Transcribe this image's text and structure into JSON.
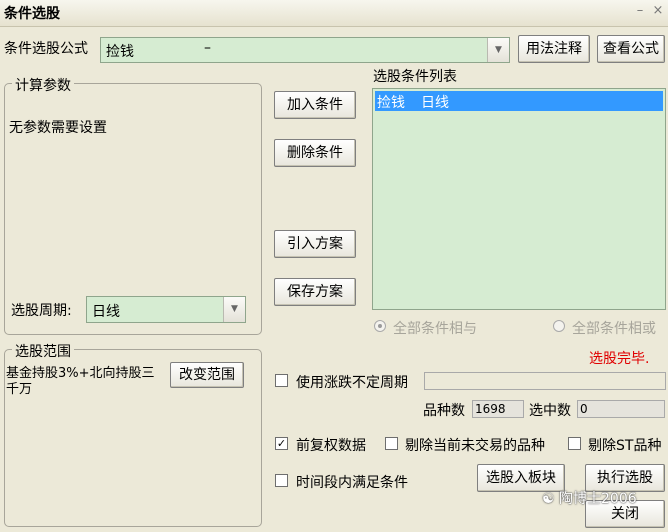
{
  "window": {
    "title": "条件选股",
    "minimize_glyph": "–",
    "close_glyph": "×"
  },
  "formula": {
    "label": "条件选股公式",
    "value": "捡钱",
    "dash": "–",
    "usage_button": "用法注释",
    "view_button": "查看公式"
  },
  "params": {
    "group_label": "计算参数",
    "empty_text": "无参数需要设置",
    "period_label": "选股周期:",
    "period_value": "日线"
  },
  "actions": {
    "add": "加入条件",
    "delete": "删除条件",
    "import": "引入方案",
    "save": "保存方案"
  },
  "conditions": {
    "label": "选股条件列表",
    "items": [
      {
        "name": "捡钱",
        "period": "日线"
      }
    ]
  },
  "logic": {
    "all_and": "全部条件相与",
    "all_or": "全部条件相或",
    "status": "选股完毕."
  },
  "scope": {
    "group_label": "选股范围",
    "text": "基金持股3%+北向持股三千万",
    "change_button": "改变范围"
  },
  "options": {
    "uncertain_period": "使用涨跌不定周期",
    "count_label": "品种数",
    "count_value": "1698",
    "selected_label": "选中数",
    "selected_value": "0",
    "pre_adjust": "前复权数据",
    "exclude_untraded": "剔除当前未交易的品种",
    "exclude_st": "剔除ST品种",
    "time_range": "时间段内满足条件",
    "to_block_button": "选股入板块",
    "run_button": "执行选股",
    "close_button": "关闭"
  },
  "watermark": "陶博士2006",
  "colors": {
    "selection": "#3399ff",
    "status": "#e00000",
    "field_bg": "#d6ecd2"
  }
}
